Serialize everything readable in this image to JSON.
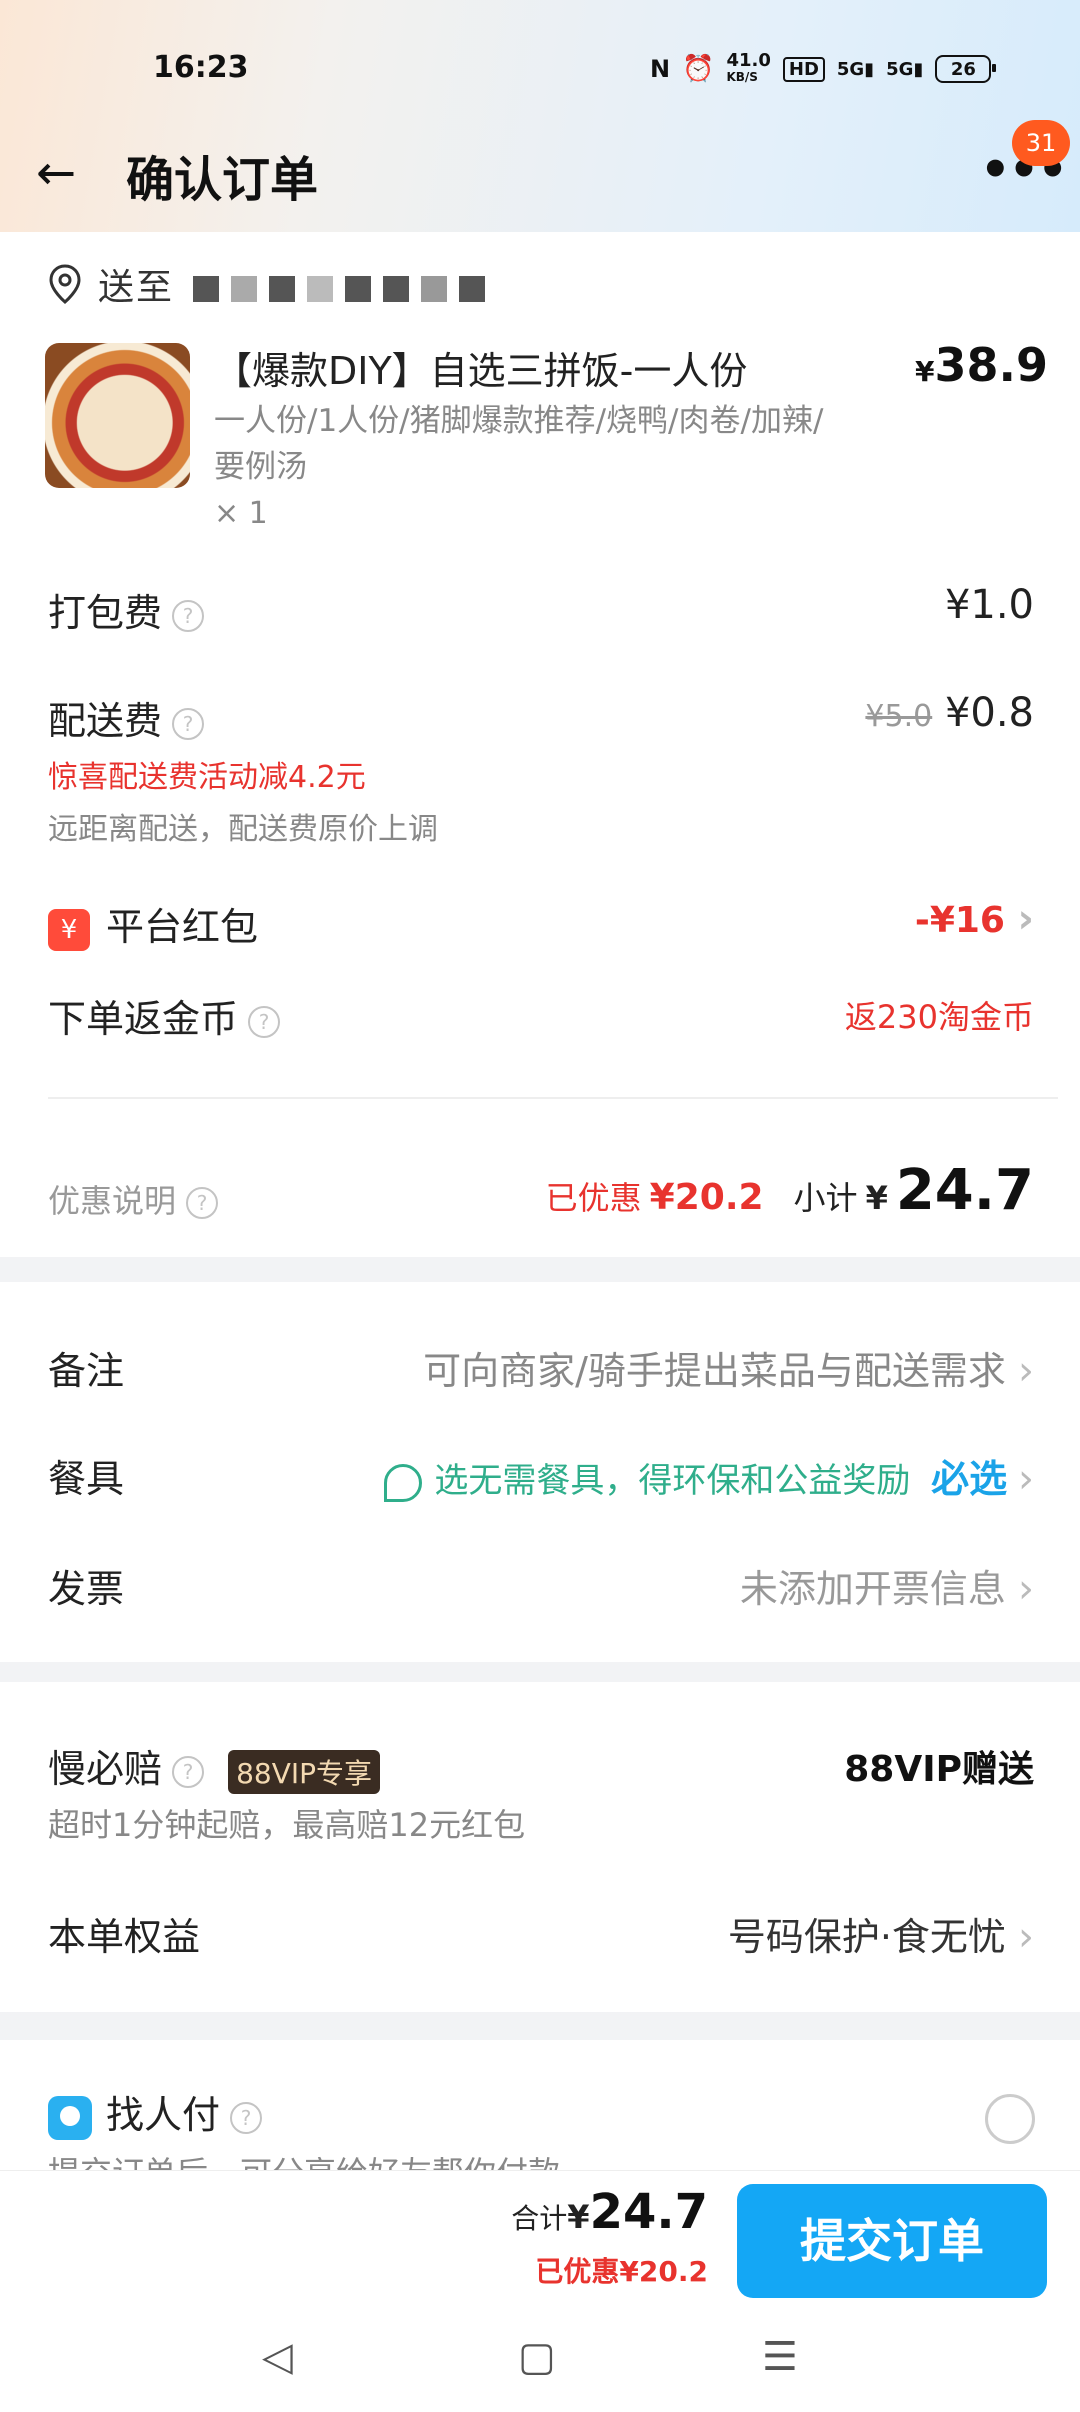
{
  "status_bar": {
    "time": "16:23",
    "net_speed": "41.0",
    "net_unit": "KB/S",
    "hd": "HD",
    "sig1": "5G",
    "sig2": "5G",
    "battery": "26"
  },
  "header": {
    "title": "确认订单",
    "badge": "31"
  },
  "address": {
    "text": "送至"
  },
  "item": {
    "name": "【爆款DIY】自选三拼饭-一人份",
    "currency": "¥",
    "price": "38.9",
    "desc": "一人份/1人份/猪脚爆款推荐/烧鸭/肉卷/加辣/要例汤",
    "qty": "× 1"
  },
  "packing": {
    "label": "打包费",
    "value": "¥1.0"
  },
  "delivery": {
    "label": "配送费",
    "original": "¥5.0",
    "value": "¥0.8",
    "promo": "惊喜配送费活动减4.2元",
    "note": "远距离配送，配送费原价上调"
  },
  "red_packet": {
    "icon": "¥",
    "label": "平台红包",
    "value": "-¥16"
  },
  "coins": {
    "label": "下单返金币",
    "value": "返230淘金币"
  },
  "summary": {
    "label": "优惠说明",
    "saved_prefix": "已优惠",
    "saved": "¥20.2",
    "subtotal_label": "小计",
    "currency": "¥",
    "subtotal": "24.7"
  },
  "options": {
    "remark_label": "备注",
    "remark_value": "可向商家/骑手提出菜品与配送需求",
    "tableware_label": "餐具",
    "tableware_value": "选无需餐具，得环保和公益奖励",
    "tableware_required": "必选",
    "invoice_label": "发票",
    "invoice_value": "未添加开票信息"
  },
  "slow_pay": {
    "label": "慢必赔",
    "vip_tag": "88VIP专享",
    "value": "88VIP赠送",
    "note": "超时1分钟起赔，最高赔12元红包"
  },
  "benefits": {
    "label": "本单权益",
    "value": "号码保护·食无忧"
  },
  "find_pay": {
    "label": "找人付",
    "note": "提交订单后，可分享给好友帮你付款"
  },
  "bottom": {
    "total_label": "合计",
    "currency": "¥",
    "total": "24.7",
    "saved": "已优惠¥20.2",
    "submit": "提交订单"
  },
  "icons": {
    "back": "arrow-left",
    "more": "dots",
    "pin": "location-pin",
    "help": "question-circle",
    "chevron": "chevron-right",
    "leaf": "eco-leaf",
    "nav_back": "triangle",
    "nav_home": "square",
    "nav_menu": "lines"
  }
}
